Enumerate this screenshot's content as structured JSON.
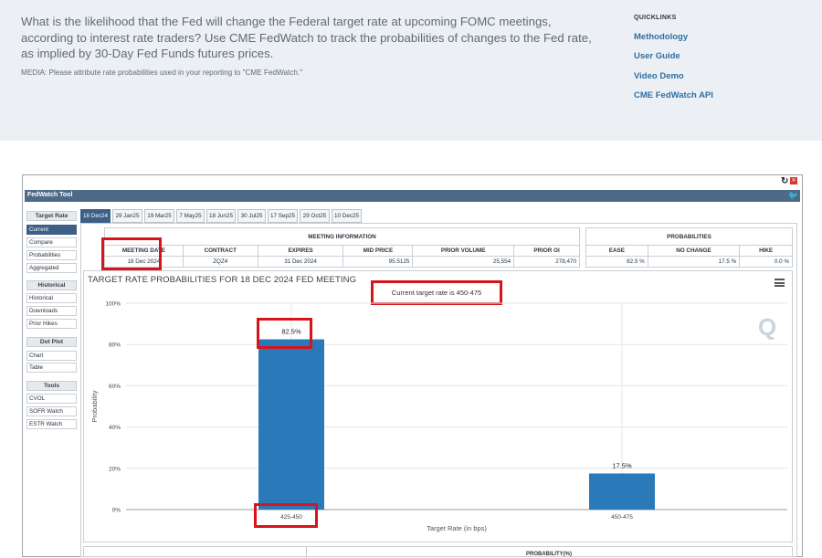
{
  "intro": {
    "text": "What is the likelihood that the Fed will change the Federal target rate at upcoming FOMC meetings, according to interest rate traders? Use CME FedWatch to track the probabilities of changes to the Fed rate, as implied by 30-Day Fed Funds futures prices.",
    "media_note": "MEDIA: Please attribute rate probabilities used in your reporting to \"CME FedWatch.\""
  },
  "quicklinks": {
    "title": "QUICKLINKS",
    "links": [
      "Methodology",
      "User Guide",
      "Video Demo",
      "CME FedWatch API"
    ]
  },
  "tool": {
    "title": "FedWatch Tool",
    "icons": {
      "refresh": "refresh-icon",
      "close": "close-icon",
      "twitter": "twitter-icon"
    }
  },
  "sidebar": {
    "sections": [
      {
        "heading": "Target Rate",
        "items": [
          "Current",
          "Compare",
          "Probabilities",
          "Aggregated"
        ]
      },
      {
        "heading": "Historical",
        "items": [
          "Historical",
          "Downloads",
          "Prior Hikes"
        ]
      },
      {
        "heading": "Dot Plot",
        "items": [
          "Chart",
          "Table"
        ]
      },
      {
        "heading": "Tools",
        "items": [
          "CVOL",
          "SOFR Watch",
          "ESTR Watch"
        ]
      }
    ],
    "active_item": "Current"
  },
  "meeting_tabs": [
    "18 Dec24",
    "29 Jan25",
    "19 Mar25",
    "7 May25",
    "18 Jun25",
    "30 Jul25",
    "17 Sep25",
    "29 Oct25",
    "10 Dec25"
  ],
  "meeting_info": {
    "header": "MEETING INFORMATION",
    "columns": [
      "MEETING DATE",
      "CONTRACT",
      "EXPIRES",
      "MID PRICE",
      "PRIOR VOLUME",
      "PRIOR OI"
    ],
    "row": [
      "18 Dec 2024",
      "ZQZ4",
      "31 Dec 2024",
      "95.5125",
      "25,554",
      "278,470"
    ]
  },
  "probabilities": {
    "header": "PROBABILITIES",
    "columns": [
      "EASE",
      "NO CHANGE",
      "HIKE"
    ],
    "row": [
      "82.5 %",
      "17.5 %",
      "0.0 %"
    ]
  },
  "chart": {
    "title": "TARGET RATE PROBABILITIES FOR 18 DEC 2024 FED MEETING",
    "current_rate_note": "Current target rate is 450-475",
    "watermark": "Q"
  },
  "chart_data": {
    "type": "bar",
    "categories": [
      "425-450",
      "450-475"
    ],
    "values": [
      82.5,
      17.5
    ],
    "data_labels": [
      "82.5%",
      "17.5%"
    ],
    "title": "TARGET RATE PROBABILITIES FOR 18 DEC 2024 FED MEETING",
    "xlabel": "Target Rate (in bps)",
    "ylabel": "Probability",
    "ylim": [
      0,
      100
    ],
    "yticks": [
      "0%",
      "20%",
      "40%",
      "60%",
      "80%",
      "100%"
    ],
    "grid": true,
    "bar_color": "#2a7ab9"
  },
  "bottom": {
    "label": "PROBABILITY(%)"
  },
  "colors": {
    "accent": "#3d5f85",
    "titlebar": "#4e6a89",
    "highlight": "#d8141b",
    "bar": "#2a7ab9",
    "link": "#2f6fa3"
  }
}
